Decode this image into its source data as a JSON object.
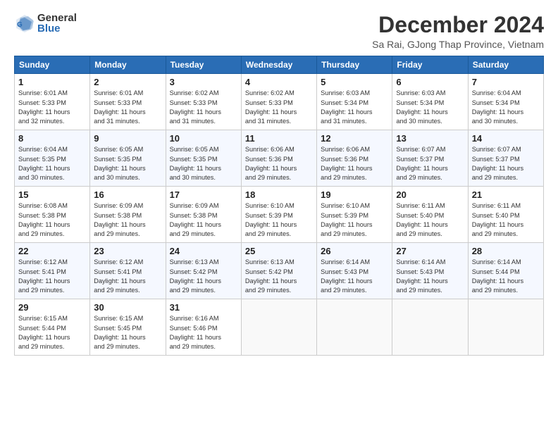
{
  "logo": {
    "general": "General",
    "blue": "Blue"
  },
  "title": "December 2024",
  "subtitle": "Sa Rai, GJong Thap Province, Vietnam",
  "weekdays": [
    "Sunday",
    "Monday",
    "Tuesday",
    "Wednesday",
    "Thursday",
    "Friday",
    "Saturday"
  ],
  "weeks": [
    [
      {
        "day": "1",
        "info": "Sunrise: 6:01 AM\nSunset: 5:33 PM\nDaylight: 11 hours\nand 32 minutes."
      },
      {
        "day": "2",
        "info": "Sunrise: 6:01 AM\nSunset: 5:33 PM\nDaylight: 11 hours\nand 31 minutes."
      },
      {
        "day": "3",
        "info": "Sunrise: 6:02 AM\nSunset: 5:33 PM\nDaylight: 11 hours\nand 31 minutes."
      },
      {
        "day": "4",
        "info": "Sunrise: 6:02 AM\nSunset: 5:33 PM\nDaylight: 11 hours\nand 31 minutes."
      },
      {
        "day": "5",
        "info": "Sunrise: 6:03 AM\nSunset: 5:34 PM\nDaylight: 11 hours\nand 31 minutes."
      },
      {
        "day": "6",
        "info": "Sunrise: 6:03 AM\nSunset: 5:34 PM\nDaylight: 11 hours\nand 30 minutes."
      },
      {
        "day": "7",
        "info": "Sunrise: 6:04 AM\nSunset: 5:34 PM\nDaylight: 11 hours\nand 30 minutes."
      }
    ],
    [
      {
        "day": "8",
        "info": "Sunrise: 6:04 AM\nSunset: 5:35 PM\nDaylight: 11 hours\nand 30 minutes."
      },
      {
        "day": "9",
        "info": "Sunrise: 6:05 AM\nSunset: 5:35 PM\nDaylight: 11 hours\nand 30 minutes."
      },
      {
        "day": "10",
        "info": "Sunrise: 6:05 AM\nSunset: 5:35 PM\nDaylight: 11 hours\nand 30 minutes."
      },
      {
        "day": "11",
        "info": "Sunrise: 6:06 AM\nSunset: 5:36 PM\nDaylight: 11 hours\nand 29 minutes."
      },
      {
        "day": "12",
        "info": "Sunrise: 6:06 AM\nSunset: 5:36 PM\nDaylight: 11 hours\nand 29 minutes."
      },
      {
        "day": "13",
        "info": "Sunrise: 6:07 AM\nSunset: 5:37 PM\nDaylight: 11 hours\nand 29 minutes."
      },
      {
        "day": "14",
        "info": "Sunrise: 6:07 AM\nSunset: 5:37 PM\nDaylight: 11 hours\nand 29 minutes."
      }
    ],
    [
      {
        "day": "15",
        "info": "Sunrise: 6:08 AM\nSunset: 5:38 PM\nDaylight: 11 hours\nand 29 minutes."
      },
      {
        "day": "16",
        "info": "Sunrise: 6:09 AM\nSunset: 5:38 PM\nDaylight: 11 hours\nand 29 minutes."
      },
      {
        "day": "17",
        "info": "Sunrise: 6:09 AM\nSunset: 5:38 PM\nDaylight: 11 hours\nand 29 minutes."
      },
      {
        "day": "18",
        "info": "Sunrise: 6:10 AM\nSunset: 5:39 PM\nDaylight: 11 hours\nand 29 minutes."
      },
      {
        "day": "19",
        "info": "Sunrise: 6:10 AM\nSunset: 5:39 PM\nDaylight: 11 hours\nand 29 minutes."
      },
      {
        "day": "20",
        "info": "Sunrise: 6:11 AM\nSunset: 5:40 PM\nDaylight: 11 hours\nand 29 minutes."
      },
      {
        "day": "21",
        "info": "Sunrise: 6:11 AM\nSunset: 5:40 PM\nDaylight: 11 hours\nand 29 minutes."
      }
    ],
    [
      {
        "day": "22",
        "info": "Sunrise: 6:12 AM\nSunset: 5:41 PM\nDaylight: 11 hours\nand 29 minutes."
      },
      {
        "day": "23",
        "info": "Sunrise: 6:12 AM\nSunset: 5:41 PM\nDaylight: 11 hours\nand 29 minutes."
      },
      {
        "day": "24",
        "info": "Sunrise: 6:13 AM\nSunset: 5:42 PM\nDaylight: 11 hours\nand 29 minutes."
      },
      {
        "day": "25",
        "info": "Sunrise: 6:13 AM\nSunset: 5:42 PM\nDaylight: 11 hours\nand 29 minutes."
      },
      {
        "day": "26",
        "info": "Sunrise: 6:14 AM\nSunset: 5:43 PM\nDaylight: 11 hours\nand 29 minutes."
      },
      {
        "day": "27",
        "info": "Sunrise: 6:14 AM\nSunset: 5:43 PM\nDaylight: 11 hours\nand 29 minutes."
      },
      {
        "day": "28",
        "info": "Sunrise: 6:14 AM\nSunset: 5:44 PM\nDaylight: 11 hours\nand 29 minutes."
      }
    ],
    [
      {
        "day": "29",
        "info": "Sunrise: 6:15 AM\nSunset: 5:44 PM\nDaylight: 11 hours\nand 29 minutes."
      },
      {
        "day": "30",
        "info": "Sunrise: 6:15 AM\nSunset: 5:45 PM\nDaylight: 11 hours\nand 29 minutes."
      },
      {
        "day": "31",
        "info": "Sunrise: 6:16 AM\nSunset: 5:46 PM\nDaylight: 11 hours\nand 29 minutes."
      },
      {
        "day": "",
        "info": ""
      },
      {
        "day": "",
        "info": ""
      },
      {
        "day": "",
        "info": ""
      },
      {
        "day": "",
        "info": ""
      }
    ]
  ]
}
